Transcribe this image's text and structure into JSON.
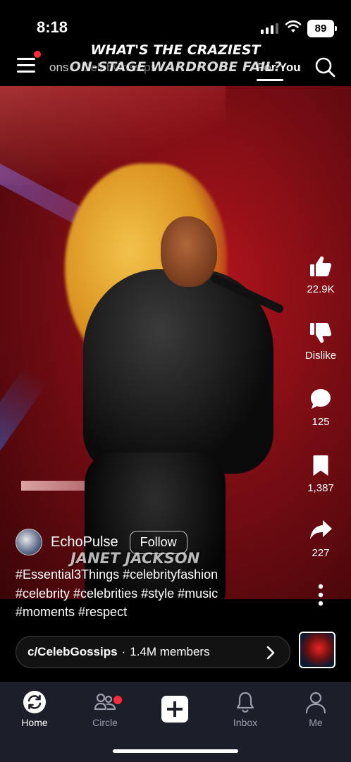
{
  "status_bar": {
    "time": "8:18",
    "battery": "89"
  },
  "top_nav": {
    "tabs": [
      "ons",
      "CelebGossips",
      "Long",
      "Following"
    ],
    "active_tab": "For You"
  },
  "video": {
    "caption_line1": "WHAT'S THE CRAZIEST",
    "caption_line2": "ON-STAGE WARDROBE FAIL?",
    "caption_lower": "JANET JACKSON"
  },
  "actions": {
    "likes": "22.9K",
    "dislike_label": "Dislike",
    "comments": "125",
    "saves": "1,387",
    "shares": "227"
  },
  "author": {
    "name": "EchoPulse",
    "follow_label": "Follow"
  },
  "description": {
    "line1": "#Essential3Things #celebrityfashion",
    "line2": "#celebrity #celebrities #style #music",
    "line3": "#moments #respect"
  },
  "community": {
    "name": "c/CelebGossips",
    "separator": "·",
    "members": "1.4M members"
  },
  "tab_bar": {
    "home": "Home",
    "circle": "Circle",
    "inbox": "Inbox",
    "me": "Me"
  },
  "icons": [
    "menu-icon",
    "search-icon",
    "like-icon",
    "dislike-icon",
    "comment-icon",
    "bookmark-icon",
    "share-icon",
    "more-icon",
    "chevron-right-icon",
    "home-icon",
    "circle-icon",
    "plus-icon",
    "bell-icon",
    "person-icon"
  ],
  "colors": {
    "notification_dot": "#ff2b3a",
    "tab_bar_bg": "#1c1f2a"
  }
}
